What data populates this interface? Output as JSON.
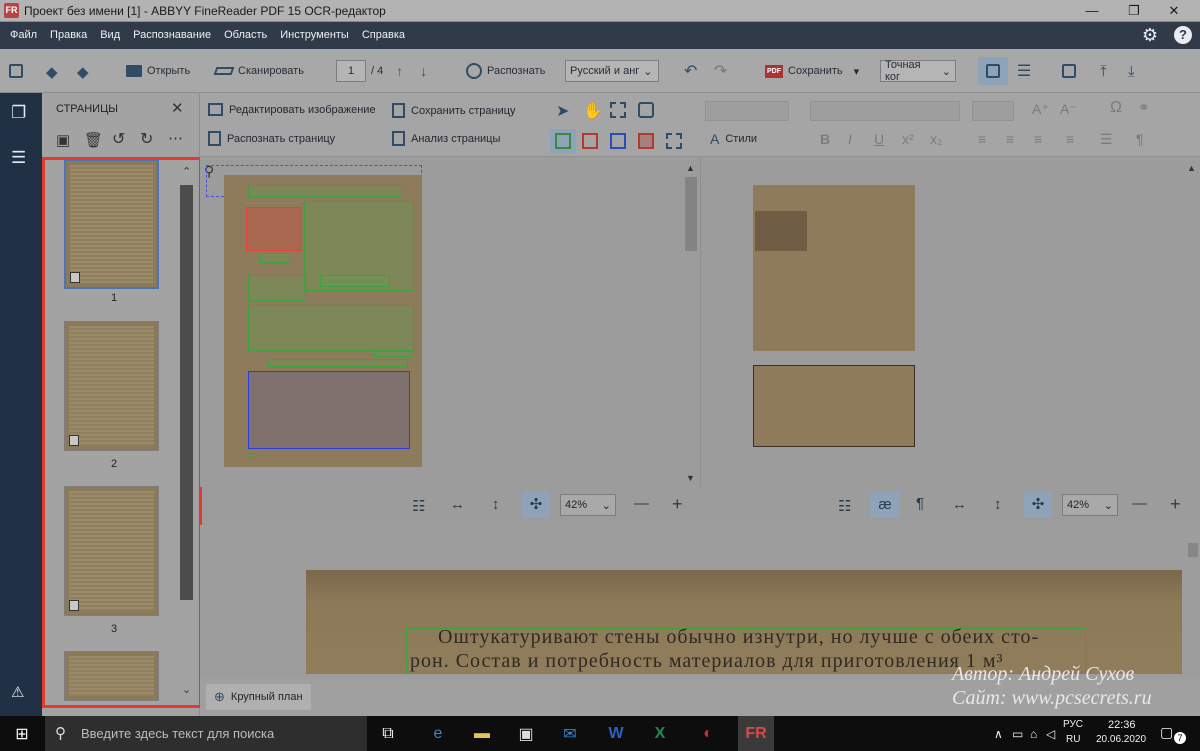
{
  "window": {
    "title": "Проект без имени [1] - ABBYY FineReader PDF 15 OCR-редактор",
    "app_icon": "FR",
    "controls": [
      "—",
      "❐",
      "✕"
    ]
  },
  "menu": [
    "Файл",
    "Правка",
    "Вид",
    "Распознавание",
    "Область",
    "Инструменты",
    "Справка"
  ],
  "toolbar": {
    "open": "Открыть",
    "scan": "Сканировать",
    "page_current": "1",
    "page_total": "/ 4",
    "recognize": "Распознать",
    "language": "Русский и анг",
    "save": "Сохранить",
    "save_icon_text": "PDF",
    "mode": "Точная ког"
  },
  "pages_panel": {
    "title": "СТРАНИЦЫ",
    "pages": [
      {
        "label": "1"
      },
      {
        "label": "2"
      },
      {
        "label": "3"
      }
    ]
  },
  "subtoolbar": {
    "edit_image": "Редактировать изображение",
    "recognize_page": "Распознать страницу",
    "save_page": "Сохранить страницу",
    "analyze_page": "Анализ страницы",
    "styles": "Стили"
  },
  "zoom": {
    "image_pane": "42%",
    "text_pane": "42%",
    "closeup_label": "Крупный план"
  },
  "closeup": {
    "line1": "Оштукатуривают стены обычно изнутри, но лучше с обеих сто-",
    "line2": "рон. Состав и потребность материалов для приготовления 1 м³"
  },
  "watermark": {
    "author": "Автор: Андрей Сухов",
    "site": "Сайт: www.pcsecrets.ru"
  },
  "taskbar": {
    "search_placeholder": "Введите здесь текст для поиска",
    "lang": "РУС",
    "lang2": "RU",
    "time": "22:36",
    "date": "20.06.2020",
    "notif_count": "7"
  },
  "colors": {
    "menu_bg": "#303a48",
    "side_strip": "#203146",
    "highlight": "#e23b2e",
    "text_zone": "#3da13d",
    "table_zone": "#2c3ee0",
    "picture_zone": "#e0433a"
  }
}
